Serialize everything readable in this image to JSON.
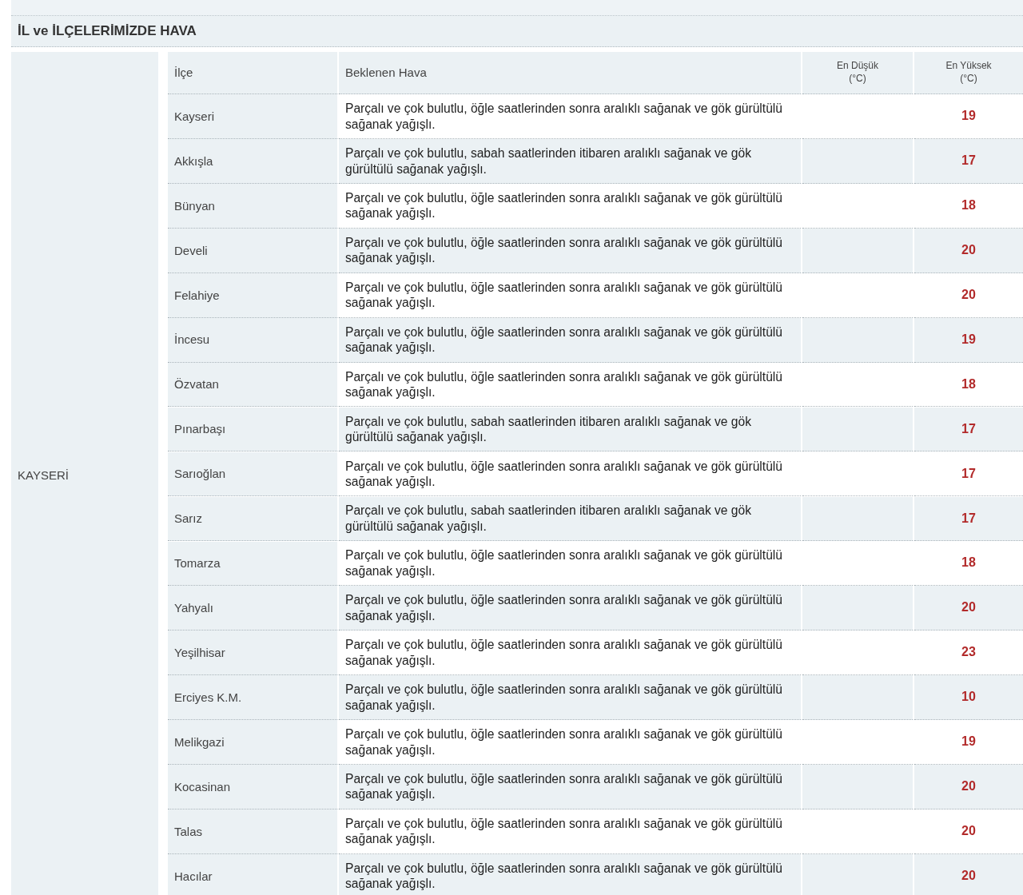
{
  "section_title": "İL ve İLÇELERİMİZDE HAVA",
  "province": "KAYSERİ",
  "table": {
    "columns": [
      {
        "label": "İlçe"
      },
      {
        "label": "Beklenen Hava"
      },
      {
        "label": "En Düşük",
        "unit": "(°C)"
      },
      {
        "label": "En Yüksek",
        "unit": "(°C)"
      }
    ],
    "rows": [
      {
        "district": "Kayseri",
        "forecast": "Parçalı ve çok bulutlu, öğle saatlerinden sonra aralıklı sağanak ve gök gürültülü sağanak yağışlı.",
        "max": "19"
      },
      {
        "district": "Akkışla",
        "forecast": "Parçalı ve çok bulutlu, sabah saatlerinden itibaren aralıklı sağanak ve gök gürültülü sağanak yağışlı.",
        "max": "17"
      },
      {
        "district": "Bünyan",
        "forecast": "Parçalı ve çok bulutlu, öğle saatlerinden sonra aralıklı sağanak ve gök gürültülü sağanak yağışlı.",
        "max": "18"
      },
      {
        "district": "Develi",
        "forecast": "Parçalı ve çok bulutlu, öğle saatlerinden sonra aralıklı sağanak ve gök gürültülü sağanak yağışlı.",
        "max": "20"
      },
      {
        "district": "Felahiye",
        "forecast": "Parçalı ve çok bulutlu, öğle saatlerinden sonra aralıklı sağanak ve gök gürültülü sağanak yağışlı.",
        "max": "20"
      },
      {
        "district": "İncesu",
        "forecast": "Parçalı ve çok bulutlu, öğle saatlerinden sonra aralıklı sağanak ve gök gürültülü sağanak yağışlı.",
        "max": "19"
      },
      {
        "district": "Özvatan",
        "forecast": "Parçalı ve çok bulutlu, öğle saatlerinden sonra aralıklı sağanak ve gök gürültülü sağanak yağışlı.",
        "max": "18"
      },
      {
        "district": "Pınarbaşı",
        "forecast": "Parçalı ve çok bulutlu, sabah saatlerinden itibaren aralıklı sağanak ve gök gürültülü sağanak yağışlı.",
        "max": "17"
      },
      {
        "district": "Sarıoğlan",
        "forecast": "Parçalı ve çok bulutlu, öğle saatlerinden sonra aralıklı sağanak ve gök gürültülü sağanak yağışlı.",
        "max": "17"
      },
      {
        "district": "Sarız",
        "forecast": "Parçalı ve çok bulutlu, sabah saatlerinden itibaren aralıklı sağanak ve gök gürültülü sağanak yağışlı.",
        "max": "17"
      },
      {
        "district": "Tomarza",
        "forecast": "Parçalı ve çok bulutlu, öğle saatlerinden sonra aralıklı sağanak ve gök gürültülü sağanak yağışlı.",
        "max": "18"
      },
      {
        "district": "Yahyalı",
        "forecast": "Parçalı ve çok bulutlu, öğle saatlerinden sonra aralıklı sağanak ve gök gürültülü sağanak yağışlı.",
        "max": "20"
      },
      {
        "district": "Yeşilhisar",
        "forecast": "Parçalı ve çok bulutlu, öğle saatlerinden sonra aralıklı sağanak ve gök gürültülü sağanak yağışlı.",
        "max": "23"
      },
      {
        "district": "Erciyes K.M.",
        "forecast": "Parçalı ve çok bulutlu, öğle saatlerinden sonra aralıklı sağanak ve gök gürültülü sağanak yağışlı.",
        "max": "10"
      },
      {
        "district": "Melikgazi",
        "forecast": "Parçalı ve çok bulutlu, öğle saatlerinden sonra aralıklı sağanak ve gök gürültülü sağanak yağışlı.",
        "max": "19"
      },
      {
        "district": "Kocasinan",
        "forecast": "Parçalı ve çok bulutlu, öğle saatlerinden sonra aralıklı sağanak ve gök gürültülü sağanak yağışlı.",
        "max": "20"
      },
      {
        "district": "Talas",
        "forecast": "Parçalı ve çok bulutlu, öğle saatlerinden sonra aralıklı sağanak ve gök gürültülü sağanak yağışlı.",
        "max": "20"
      },
      {
        "district": "Hacılar",
        "forecast": "Parçalı ve çok bulutlu, öğle saatlerinden sonra aralıklı sağanak ve gök gürültülü sağanak yağışlı.",
        "max": "20"
      }
    ]
  }
}
